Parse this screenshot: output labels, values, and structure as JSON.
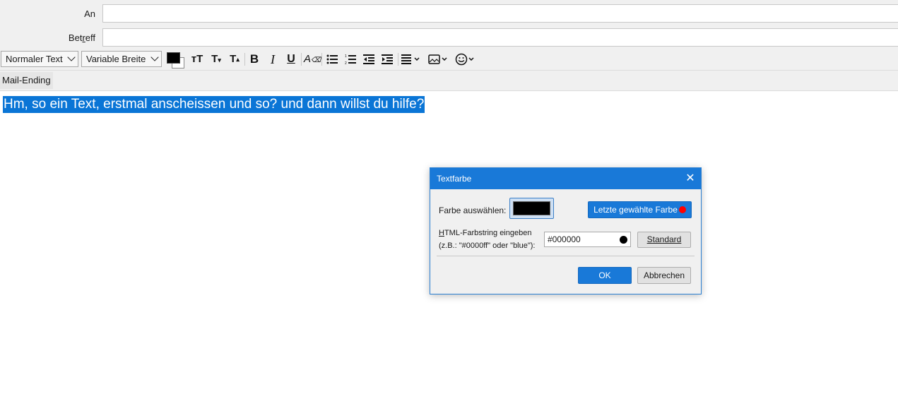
{
  "compose": {
    "to_label": "An",
    "subject_label": "Betreff",
    "to_value": "",
    "subject_value": ""
  },
  "toolbar": {
    "paragraph_format": "Normaler Text",
    "font": "Variable Breite",
    "text_color": "#000000",
    "icons": [
      "text-color-swatch",
      "font-size-smaller-icon",
      "font-size-larger-icon",
      "superscript-size-icon",
      "bold-icon",
      "italic-icon",
      "underline-icon",
      "remove-formatting-icon",
      "bullet-list-icon",
      "numbered-list-icon",
      "outdent-icon",
      "indent-icon",
      "align-icon",
      "insert-image-icon",
      "emoji-icon"
    ]
  },
  "signature": {
    "chip": "Mail-Ending"
  },
  "body": {
    "selected_text": "Hm, so ein Text, erstmal anscheissen und so? und dann willst du hilfe?"
  },
  "dialog": {
    "title": "Textfarbe",
    "pick_label": "Farbe auswählen:",
    "current_color": "#000000",
    "last_color_button": "Letzte gewählte Farbe",
    "last_color": "#ff0000",
    "html_label_line1": "HTML-Farbstring eingeben",
    "html_label_line2": "(z.B.: \"#0000ff\" oder \"blue\"):",
    "hex_value": "#000000",
    "standard_button": "Standard",
    "ok_button": "OK",
    "cancel_button": "Abbrechen"
  },
  "colors": {
    "accent": "#1979d8",
    "selection": "#0a75d6"
  }
}
